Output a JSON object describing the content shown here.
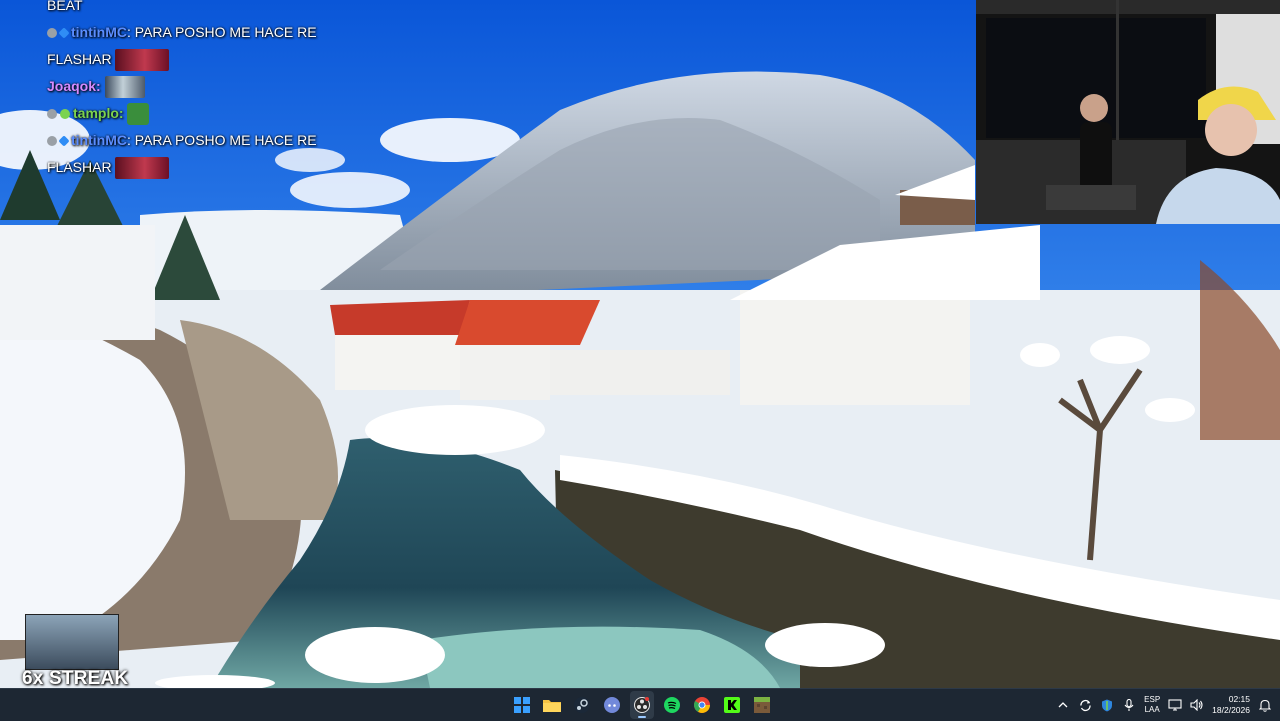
{
  "chat": {
    "messages": [
      {
        "user": "",
        "text": "BEAT",
        "name_color": "#ffffff"
      },
      {
        "user": "tintinMC",
        "sep": ": ",
        "text": "PARA POSHO ME HACE RE",
        "name_color": "#5a8dff"
      },
      {
        "user": "",
        "text": "FLASHAR",
        "name_color": "#ffffff"
      },
      {
        "user": "Joaqok",
        "sep": ":",
        "text": "",
        "name_color": "#d58bff"
      },
      {
        "user": "tamplo",
        "sep": ":",
        "text": "",
        "name_color": "#7bd34f"
      },
      {
        "user": "tintinMC",
        "sep": ": ",
        "text": "PARA POSHO ME HACE RE",
        "name_color": "#5a8dff"
      },
      {
        "user": "",
        "text": "FLASHAR",
        "name_color": "#ffffff"
      }
    ]
  },
  "streak": {
    "label": "6x STREAK"
  },
  "taskbar": {
    "apps": [
      {
        "name": "windows-start",
        "icon": "windows-icon",
        "color": "#3aa0ff"
      },
      {
        "name": "file-explorer",
        "icon": "folder-icon",
        "color": "#f6c343"
      },
      {
        "name": "steam",
        "icon": "steam-icon",
        "color": "#c7d5e0"
      },
      {
        "name": "discord",
        "icon": "discord-icon",
        "color": "#7289da"
      },
      {
        "name": "obs",
        "icon": "obs-icon",
        "color": "#e6e6e6"
      },
      {
        "name": "spotify",
        "icon": "spotify-icon",
        "color": "#1ed760"
      },
      {
        "name": "chrome",
        "icon": "chrome-icon",
        "color": "#fbbc05"
      },
      {
        "name": "kick",
        "icon": "kick-icon",
        "color": "#53fc18"
      },
      {
        "name": "minecraft",
        "icon": "minecraft-icon",
        "color": "#7cb342"
      }
    ],
    "tray": {
      "lang_top": "ESP",
      "lang_bottom": "LAA",
      "time": "02:15",
      "date": "18/2/2026"
    }
  }
}
